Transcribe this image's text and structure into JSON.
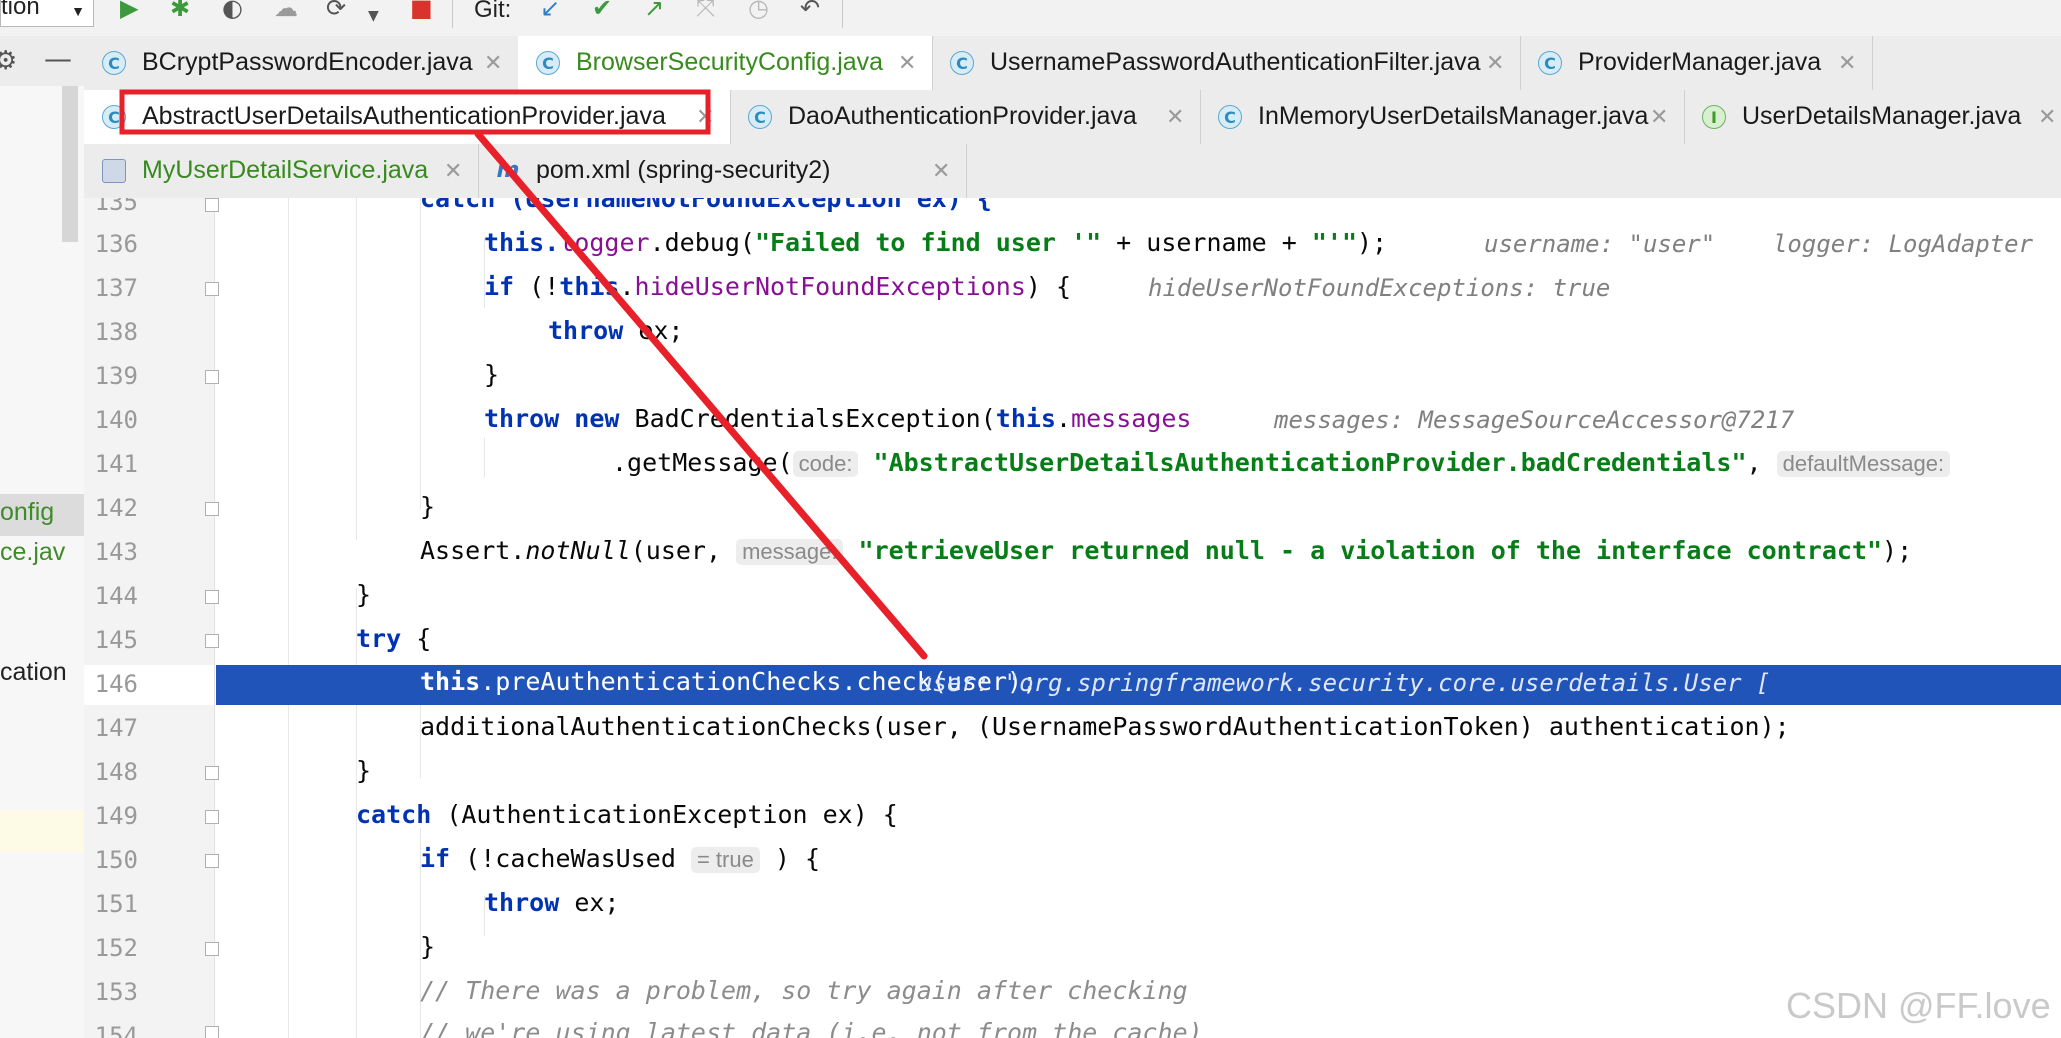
{
  "toolbar": {
    "run_config": "tion",
    "git_label": "Git:"
  },
  "sidebar": {
    "items": [
      "onfig",
      "ce.jav",
      "cation"
    ]
  },
  "tabs_row1": [
    {
      "label": "BCryptPasswordEncoder.java",
      "icon": "C"
    },
    {
      "label": "BrowserSecurityConfig.java",
      "icon": "C"
    },
    {
      "label": "UsernamePasswordAuthenticationFilter.java",
      "icon": "C"
    },
    {
      "label": "ProviderManager.java",
      "icon": "C"
    }
  ],
  "tabs_row2": [
    {
      "label": "AbstractUserDetailsAuthenticationProvider.java",
      "icon": "C"
    },
    {
      "label": "DaoAuthenticationProvider.java",
      "icon": "C"
    },
    {
      "label": "InMemoryUserDetailsManager.java",
      "icon": "C"
    },
    {
      "label": "UserDetailsManager.java",
      "icon": "I"
    }
  ],
  "tabs_row3": [
    {
      "label": "MyUserDetailService.java",
      "icon": "C"
    },
    {
      "label": "pom.xml (spring-security2)",
      "icon": "m"
    }
  ],
  "line_numbers": [
    "135",
    "136",
    "137",
    "138",
    "139",
    "140",
    "141",
    "142",
    "143",
    "144",
    "145",
    "146",
    "147",
    "148",
    "149",
    "150",
    "151",
    "152",
    "153",
    "154"
  ],
  "code": {
    "l135": "catch (UsernameNotFoundException ex) {",
    "l136_a": "this.",
    "l136_b": "logger",
    "l136_c": ".debug(",
    "l136_d": "\"Failed to find user '\"",
    "l136_e": " + username + ",
    "l136_f": "\"'\"",
    "l136_g": ");",
    "l136_hint": "username: \"user\"    logger: LogAdapter",
    "l137_a": "if",
    "l137_b": " (!",
    "l137_c": "this",
    "l137_d": ".",
    "l137_e": "hideUserNotFoundExceptions",
    "l137_f": ") {",
    "l137_hint": "hideUserNotFoundExceptions: true",
    "l138_a": "throw",
    "l138_b": " ex;",
    "l139": "}",
    "l140_a": "throw new",
    "l140_b": " BadCredentialsException(",
    "l140_c": "this",
    "l140_d": ".",
    "l140_e": "messages",
    "l140_hint": "messages: MessageSourceAccessor@7217",
    "l141_a": ".getMessage(",
    "l141_param": "code:",
    "l141_b": "\"AbstractUserDetailsAuthenticationProvider.badCredentials\"",
    "l141_c": ",",
    "l141_param2": "defaultMessage:",
    "l142": "}",
    "l143_a": "Assert.",
    "l143_b": "notNull",
    "l143_c": "(user,",
    "l143_param": "message:",
    "l143_d": "\"retrieveUser returned null - a violation of the interface contract\"",
    "l143_e": ");",
    "l144": "}",
    "l145_a": "try",
    "l145_b": " {",
    "l146_a": "this",
    "l146_b": ".preAuthenticationChecks.check(user);",
    "l146_hint": "user: \"org.springframework.security.core.userdetails.User [",
    "l147": "additionalAuthenticationChecks(user, (UsernamePasswordAuthenticationToken) authentication);",
    "l148": "}",
    "l149_a": "catch",
    "l149_b": " (AuthenticationException ex) {",
    "l150_a": "if",
    "l150_b": " (!cacheWasUsed",
    "l150_param": "= true",
    "l150_c": ") {",
    "l151_a": "throw",
    "l151_b": " ex;",
    "l152": "}",
    "l153": "// There was a problem, so try again after checking",
    "l154": "// we're using latest data (i.e. not from the cache)"
  },
  "watermark": "CSDN @FF.love",
  "colors": {
    "annotation_red": "#e8202a",
    "selection_blue": "#2154b9",
    "keyword": "#0033b3",
    "string": "#067d17",
    "field": "#871094"
  }
}
